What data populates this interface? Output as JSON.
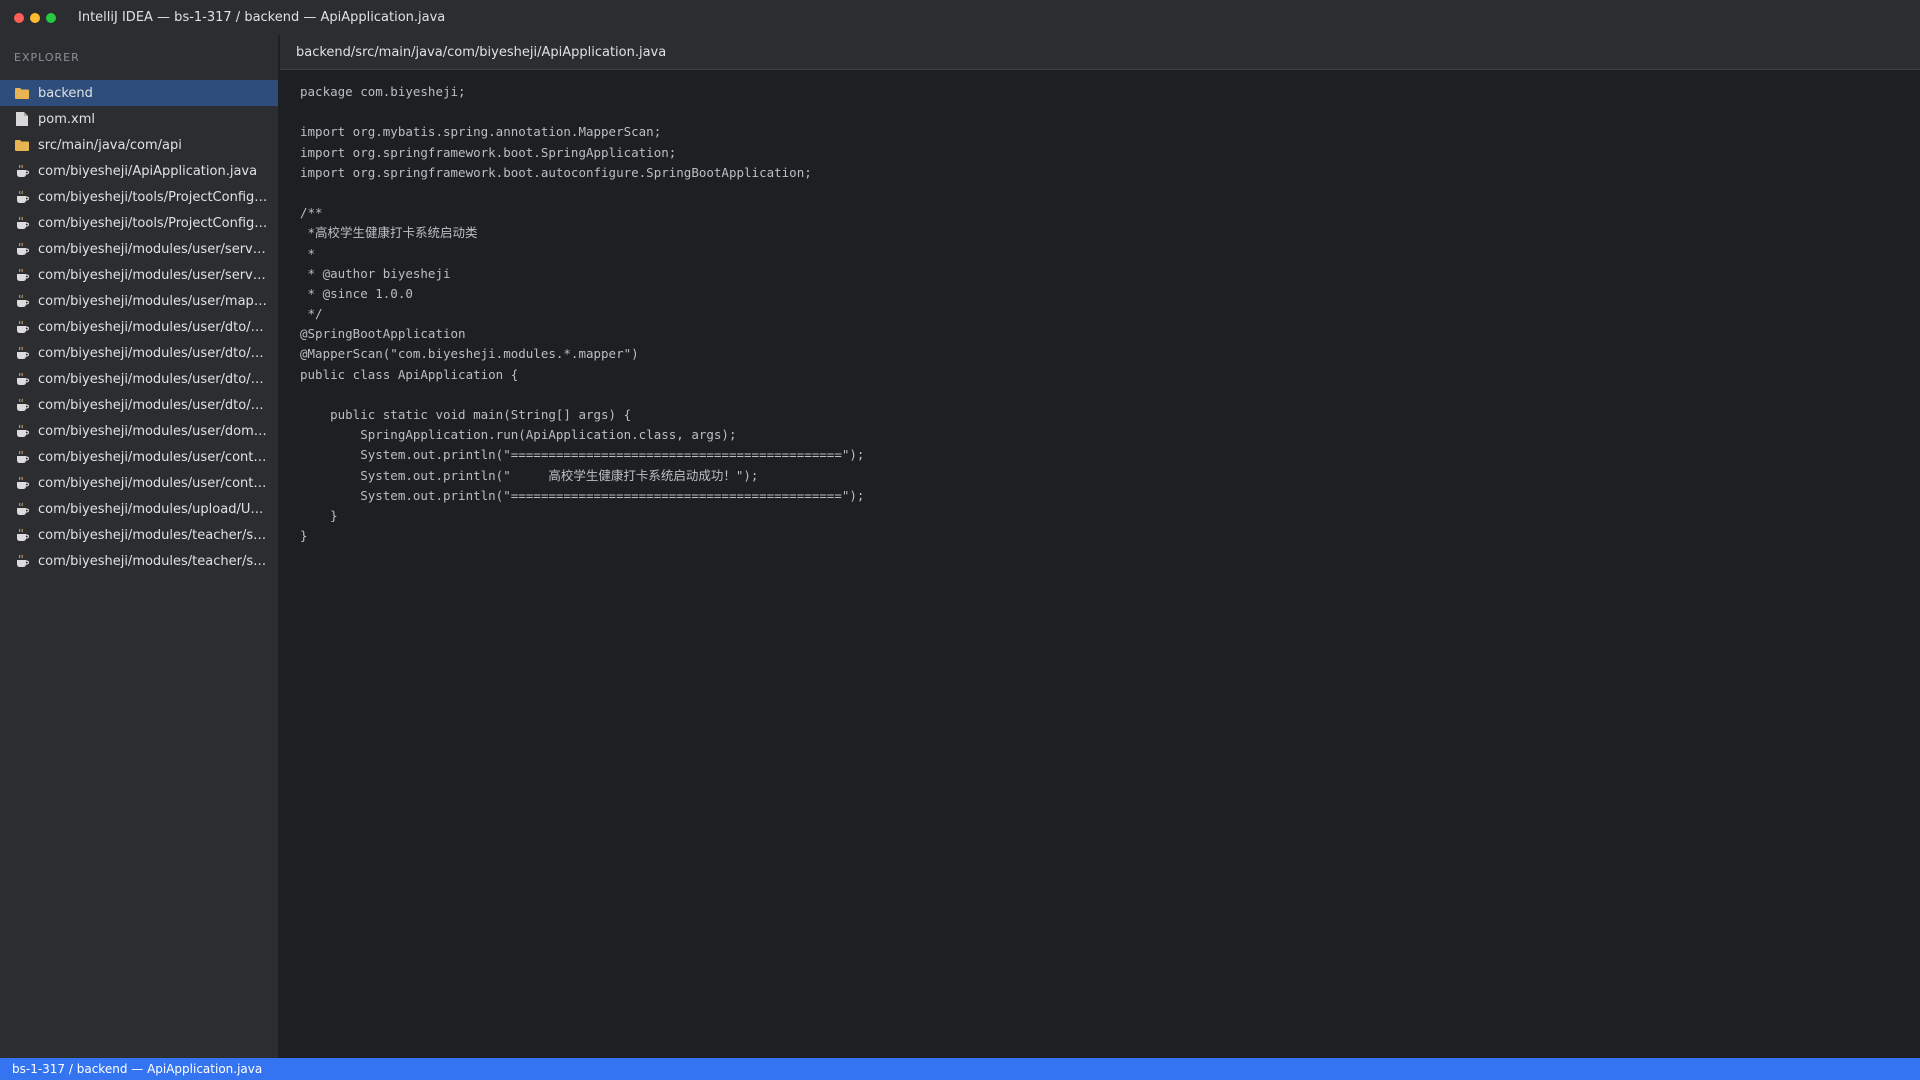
{
  "window": {
    "title": "IntelliJ IDEA — bs-1-317 / backend — ApiApplication.java"
  },
  "sidebar": {
    "header": "EXPLORER",
    "items": [
      {
        "label": "backend",
        "icon": "folder-icon",
        "selected": true
      },
      {
        "label": "pom.xml",
        "icon": "file-icon"
      },
      {
        "label": "src/main/java/com/api",
        "icon": "folder-icon"
      },
      {
        "label": "com/biyesheji/ApiApplication.java",
        "icon": "java-file-icon"
      },
      {
        "label": "com/biyesheji/tools/ProjectConfigA...",
        "icon": "java-file-icon"
      },
      {
        "label": "com/biyesheji/tools/ProjectConfigT...",
        "icon": "java-file-icon"
      },
      {
        "label": "com/biyesheji/modules/user/servic...",
        "icon": "java-file-icon"
      },
      {
        "label": "com/biyesheji/modules/user/servic...",
        "icon": "java-file-icon"
      },
      {
        "label": "com/biyesheji/modules/user/mapp...",
        "icon": "java-file-icon"
      },
      {
        "label": "com/biyesheji/modules/user/dto/P...",
        "icon": "java-file-icon"
      },
      {
        "label": "com/biyesheji/modules/user/dto/U...",
        "icon": "java-file-icon"
      },
      {
        "label": "com/biyesheji/modules/user/dto/U...",
        "icon": "java-file-icon"
      },
      {
        "label": "com/biyesheji/modules/user/dto/U...",
        "icon": "java-file-icon"
      },
      {
        "label": "com/biyesheji/modules/user/doma...",
        "icon": "java-file-icon"
      },
      {
        "label": "com/biyesheji/modules/user/contr...",
        "icon": "java-file-icon"
      },
      {
        "label": "com/biyesheji/modules/user/contr...",
        "icon": "java-file-icon"
      },
      {
        "label": "com/biyesheji/modules/upload/Upl...",
        "icon": "java-file-icon"
      },
      {
        "label": "com/biyesheji/modules/teacher/se...",
        "icon": "java-file-icon"
      },
      {
        "label": "com/biyesheji/modules/teacher/se...",
        "icon": "java-file-icon"
      }
    ]
  },
  "editor": {
    "breadcrumb": "backend/src/main/java/com/biyesheji/ApiApplication.java",
    "lines": [
      "package com.biyesheji;",
      "",
      "import org.mybatis.spring.annotation.MapperScan;",
      "import org.springframework.boot.SpringApplication;",
      "import org.springframework.boot.autoconfigure.SpringBootApplication;",
      "",
      "/**",
      " *高校学生健康打卡系统启动类",
      " *",
      " * @author biyesheji",
      " * @since 1.0.0",
      " */",
      "@SpringBootApplication",
      "@MapperScan(\"com.biyesheji.modules.*.mapper\")",
      "public class ApiApplication {",
      "",
      "    public static void main(String[] args) {",
      "        SpringApplication.run(ApiApplication.class, args);",
      "        System.out.println(\"============================================\");",
      "        System.out.println(\"     高校学生健康打卡系统启动成功！\");",
      "        System.out.println(\"============================================\");",
      "    }",
      "}"
    ]
  },
  "statusbar": {
    "text": "bs-1-317 / backend — ApiApplication.java"
  },
  "colors": {
    "accent": "#3574f0",
    "selection": "#2e4d7a",
    "folder": "#e6b450",
    "java": "#c9a36b"
  }
}
